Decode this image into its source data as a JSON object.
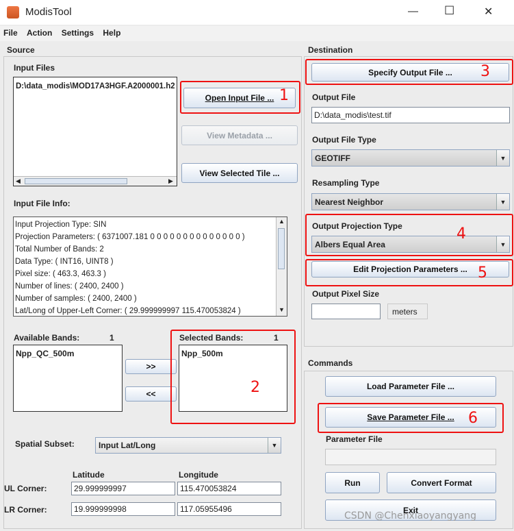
{
  "window": {
    "title": "ModisTool",
    "minimize_glyph": "—",
    "maximize_glyph": "☐",
    "close_glyph": "✕"
  },
  "menu": {
    "items": [
      "File",
      "Action",
      "Settings",
      "Help"
    ]
  },
  "source": {
    "section_label": "Source",
    "input_files": {
      "label": "Input Files",
      "items": [
        "D:\\data_modis\\MOD17A3HGF.A2000001.h2"
      ]
    },
    "open_input_file_button": "Open Input File ...",
    "view_metadata_button": "View Metadata ...",
    "view_selected_tile_button": "View Selected Tile ...",
    "input_file_info": {
      "label": "Input File Info:",
      "lines": [
        "Input Projection Type: SIN",
        "Projection Parameters: ( 6371007.181 0 0 0 0 0 0 0 0 0 0 0 0 0 0 )",
        "Total Number of Bands: 2",
        "Data Type: ( INT16, UINT8 )",
        "Pixel size: ( 463.3, 463.3 )",
        "Number of lines: ( 2400, 2400 )",
        "Number of samples: ( 2400, 2400 )",
        "Lat/Long of Upper-Left Corner: ( 29.999999997 115.470053824 )"
      ]
    },
    "available_bands": {
      "label": "Available Bands:",
      "count": "1",
      "items": [
        "Npp_QC_500m"
      ]
    },
    "selected_bands": {
      "label": "Selected Bands:",
      "count": "1",
      "items": [
        "Npp_500m"
      ]
    },
    "add_band_button": ">>",
    "remove_band_button": "<<",
    "spatial_subset": {
      "label": "Spatial Subset:",
      "value": "Input Lat/Long"
    },
    "corners": {
      "latitude_label": "Latitude",
      "longitude_label": "Longitude",
      "ul_label": "UL Corner:",
      "lr_label": "LR Corner:",
      "ul_lat": "29.999999997",
      "ul_lon": "115.470053824",
      "lr_lat": "19.999999998",
      "lr_lon": "117.05955496"
    }
  },
  "destination": {
    "section_label": "Destination",
    "specify_output_button": "Specify Output File ...",
    "output_file": {
      "label": "Output File",
      "value": "D:\\data_modis\\test.tif"
    },
    "output_file_type": {
      "label": "Output File Type",
      "value": "GEOTIFF"
    },
    "resampling_type": {
      "label": "Resampling Type",
      "value": "Nearest Neighbor"
    },
    "output_projection_type": {
      "label": "Output Projection Type",
      "value": "Albers Equal Area"
    },
    "edit_projection_button": "Edit Projection Parameters ...",
    "output_pixel_size": {
      "label": "Output Pixel Size",
      "value": "",
      "unit": "meters"
    }
  },
  "commands": {
    "section_label": "Commands",
    "load_param_button": "Load Parameter File ...",
    "save_param_button": "Save Parameter File ...",
    "parameter_file": {
      "label": "Parameter File",
      "value": ""
    },
    "run_button": "Run",
    "convert_button": "Convert Format",
    "exit_button": "Exit"
  },
  "annotations": [
    "1",
    "2",
    "3",
    "4",
    "5",
    "6"
  ],
  "watermark": "CSDN @Chenxiaoyangyang",
  "colors": {
    "annotation_red": "#e11111",
    "button_border": "#8fa4c1",
    "background": "#ececec"
  }
}
